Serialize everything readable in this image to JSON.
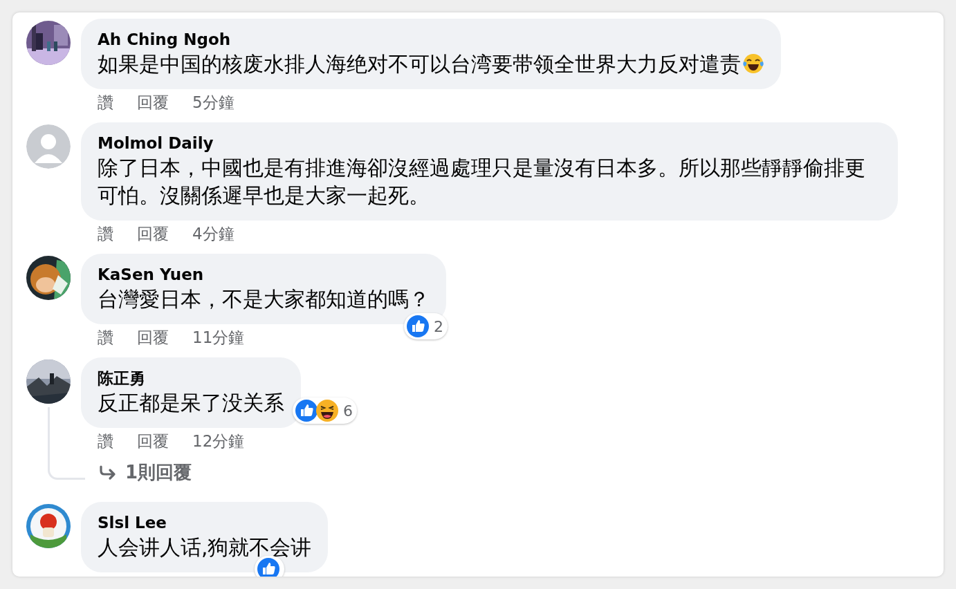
{
  "comments": [
    {
      "author": "Ah Ching Ngoh",
      "text": "如果是中国的核废水排人海绝对不可以台湾要带领全世界大力反对遣责",
      "emoji": true,
      "actions": [
        "讚",
        "回覆"
      ],
      "time": "5分鐘"
    },
    {
      "author": "Molmol Daily",
      "avatar": {
        "kind": "default"
      },
      "text": "除了日本，中國也是有排進海卻沒經過處理只是量沒有日本多。所以那些靜靜偷排更可怕。沒關係遲早也是大家一起死。",
      "actions": [
        "讚",
        "回覆"
      ],
      "time": "4分鐘"
    },
    {
      "author": "KaSen Yuen",
      "text": "台灣愛日本，不是大家都知道的嗎？",
      "actions": [
        "讚",
        "回覆"
      ],
      "time": "11分鐘",
      "reactions": {
        "icons": [
          {
            "kind": "like"
          }
        ],
        "count": "2"
      }
    },
    {
      "author": "陈正勇",
      "text": "反正都是呆了没关系",
      "actions": [
        "讚",
        "回覆"
      ],
      "time": "12分鐘",
      "reactions": {
        "icons": [
          {
            "kind": "like"
          },
          {
            "kind": "haha"
          }
        ],
        "count": "6"
      },
      "replies": {
        "label": "1則回覆"
      }
    },
    {
      "author": "Slsl Lee",
      "text": "人会讲人话,狗就不会讲",
      "reactions": {
        "icons": [
          {
            "kind": "like"
          }
        ]
      }
    }
  ]
}
